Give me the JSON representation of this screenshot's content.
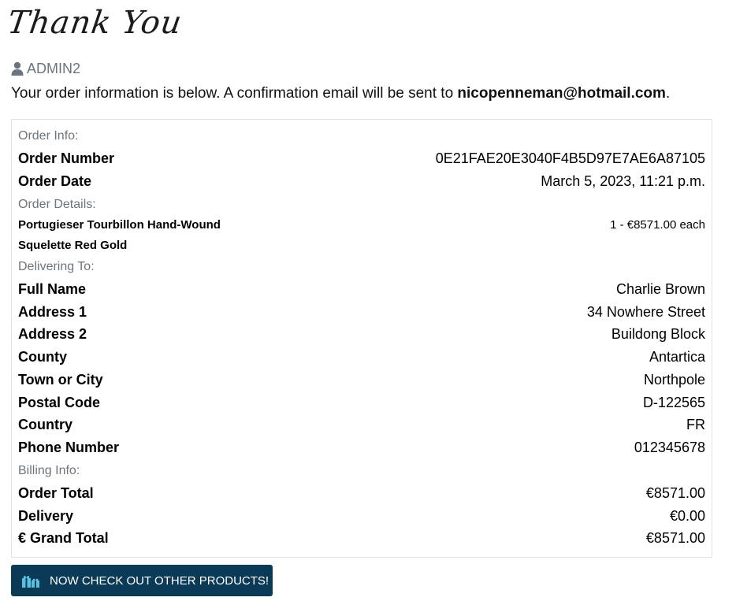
{
  "header": {
    "thanks": "Thank You"
  },
  "user": {
    "name": "ADMIN2",
    "icon": "user-icon"
  },
  "intro": {
    "text": "Your order information is below. A confirmation email will be sent to ",
    "email": "nicopenneman@hotmail.com",
    "end": "."
  },
  "order": {
    "section_info": "Order Info:",
    "number_label": "Order Number",
    "number_value": "0E21FAE20E3040F4B5D97E7AE6A87105",
    "date_label": "Order Date",
    "date_value": "March 5, 2023, 11:21 p.m.",
    "section_details": "Order Details:",
    "product_line1": "Portugieser Tourbillon Hand-Wound",
    "product_line2": "Squelette Red Gold",
    "product_qty": "1 - €8571.00 each",
    "section_delivery": "Delivering To:",
    "fields": [
      {
        "label": "Full Name",
        "value": "Charlie Brown"
      },
      {
        "label": "Address 1",
        "value": "34 Nowhere Street"
      },
      {
        "label": "Address 2",
        "value": "Buildong Block"
      },
      {
        "label": "County",
        "value": "Antartica"
      },
      {
        "label": "Town or City",
        "value": "Northpole"
      },
      {
        "label": "Postal Code",
        "value": "D-122565"
      },
      {
        "label": "Country",
        "value": "FR"
      },
      {
        "label": "Phone Number",
        "value": "012345678"
      }
    ],
    "section_billing": "Billing Info:",
    "billing": [
      {
        "label": "Order Total",
        "value": "€8571.00"
      },
      {
        "label": "Delivery",
        "value": "€0.00"
      },
      {
        "label": "€ Grand Total",
        "value": "€8571.00"
      }
    ]
  },
  "cta": {
    "label": "NOW CHECK OUT OTHER PRODUCTS!",
    "icon": "gifts-icon"
  },
  "colors": {
    "button_bg": "#0b3a57",
    "muted": "#6c757d",
    "border": "#dee2e6"
  }
}
